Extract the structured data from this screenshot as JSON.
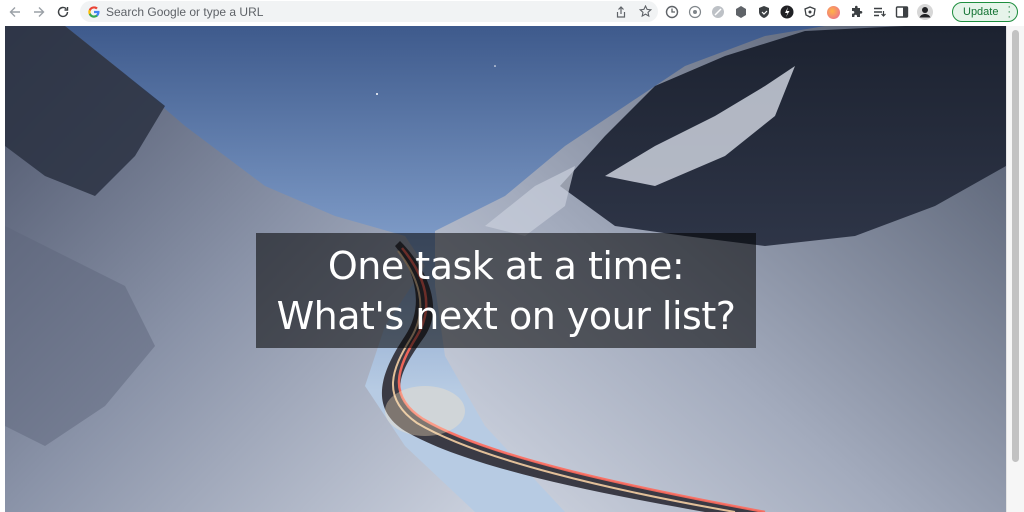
{
  "browser": {
    "omnibox": {
      "placeholder": "Search Google or type a URL"
    },
    "update_label": "Update",
    "extensions": [
      "extension-1",
      "extension-2",
      "extension-3",
      "extension-4",
      "extension-5",
      "extension-6",
      "extension-7",
      "extension-8",
      "extension-9",
      "puzzle-icon",
      "reading-list-icon",
      "side-panel-icon",
      "profile-avatar"
    ]
  },
  "main": {
    "prompt": "One task at a time: What's next on your list?",
    "background": "snowy mountain valley road with light trails at dusk"
  },
  "colors": {
    "update_border": "#1e8e3e",
    "update_text": "#137333",
    "overlay": "rgba(0,0,0,0.55)"
  }
}
